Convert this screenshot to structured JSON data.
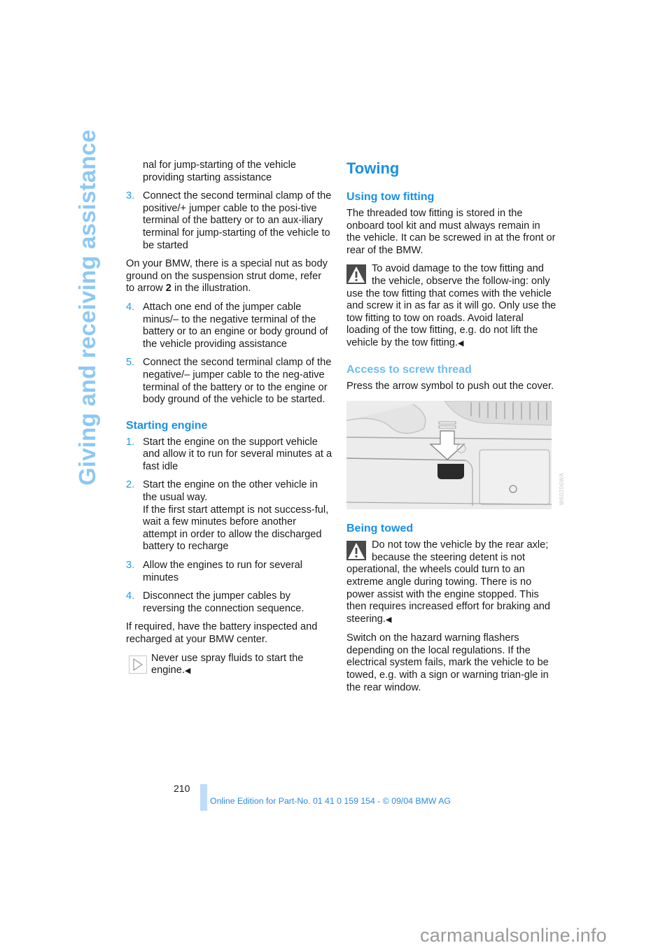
{
  "side_title": "Giving and receiving assistance",
  "left_column": {
    "intro_cont": "nal for jump-starting of the vehicle providing starting assistance",
    "steps_a": [
      {
        "num": "3.",
        "text": "Connect the second terminal clamp of the positive/+ jumper cable to the posi-tive terminal of the battery or to an aux-iliary terminal for jump-starting of the vehicle to be started"
      }
    ],
    "bmw_note_pre": "On your BMW, there is a special nut as body ground on the suspension strut dome, refer to arrow ",
    "bmw_note_bold": "2",
    "bmw_note_post": " in the illustration.",
    "steps_b": [
      {
        "num": "4.",
        "text": "Attach one end of the jumper cable minus/– to the negative terminal of the battery or to an engine or body ground of the vehicle providing assistance"
      },
      {
        "num": "5.",
        "text": "Connect the second terminal clamp of the negative/– jumper cable to the neg-ative terminal of the battery or to the engine or body ground of the vehicle to be started."
      }
    ],
    "starting_engine": {
      "heading": "Starting engine",
      "steps": [
        {
          "num": "1.",
          "text": "Start the engine on the support vehicle and allow it to run for several minutes at a fast idle"
        },
        {
          "num": "2.",
          "text": "Start the engine on the other vehicle in the usual way."
        },
        {
          "num": "3.",
          "text": "Allow the engines to run for several minutes"
        },
        {
          "num": "4.",
          "text": "Disconnect the jumper cables by reversing the connection sequence."
        }
      ],
      "step2_extra": "If the first start attempt is not success-ful, wait a few minutes before another attempt in order to allow the discharged battery to recharge"
    },
    "battery_note": "If required, have the battery inspected and recharged at your BMW center.",
    "tip": {
      "icon": "play-arrow-icon",
      "text": "Never use spray fluids to start the engine.",
      "end_mark": "◀"
    }
  },
  "right_column": {
    "title": "Towing",
    "using_tow_fitting": {
      "heading": "Using tow fitting",
      "text": "The threaded tow fitting is stored in the onboard tool kit and must always remain in the vehicle. It can be screwed in at the front or rear of the BMW.",
      "warning": {
        "icon": "warning-triangle-icon",
        "text": "To avoid damage to the tow fitting and the vehicle, observe the follow-ing: only use the tow fitting that comes with the vehicle and screw it in as far as it will go. Only use the tow fitting to tow on roads. Avoid lateral loading of the tow fitting, e.g. do not lift the vehicle by the tow fitting.",
        "end_mark": "◀"
      }
    },
    "access_screw_thread": {
      "heading": "Access to screw thread",
      "text": "Press the arrow symbol to push out the cover.",
      "illustration_code": "W60206WA"
    },
    "being_towed": {
      "heading": "Being towed",
      "warning": {
        "icon": "warning-triangle-icon",
        "text": "Do not tow the vehicle by the rear axle; because the steering detent is not operational, the wheels could turn to an extreme angle during towing. There is no power assist with the engine stopped. This then requires increased effort for braking and steering.",
        "end_mark": "◀"
      },
      "text": "Switch on the hazard warning flashers depending on the local regulations. If the electrical system fails, mark the vehicle to be towed, e.g. with a sign or warning trian-gle in the rear window."
    }
  },
  "footer": {
    "page_number": "210",
    "edition": "Online Edition for Part-No. 01 41 0 159 154 - © 09/04 BMW AG"
  },
  "watermark": "carmanualsonline.info",
  "colors": {
    "accent": "#1a8fe6",
    "side_title": "#8cc8f5",
    "footer_bar": "#bfdcf8"
  }
}
